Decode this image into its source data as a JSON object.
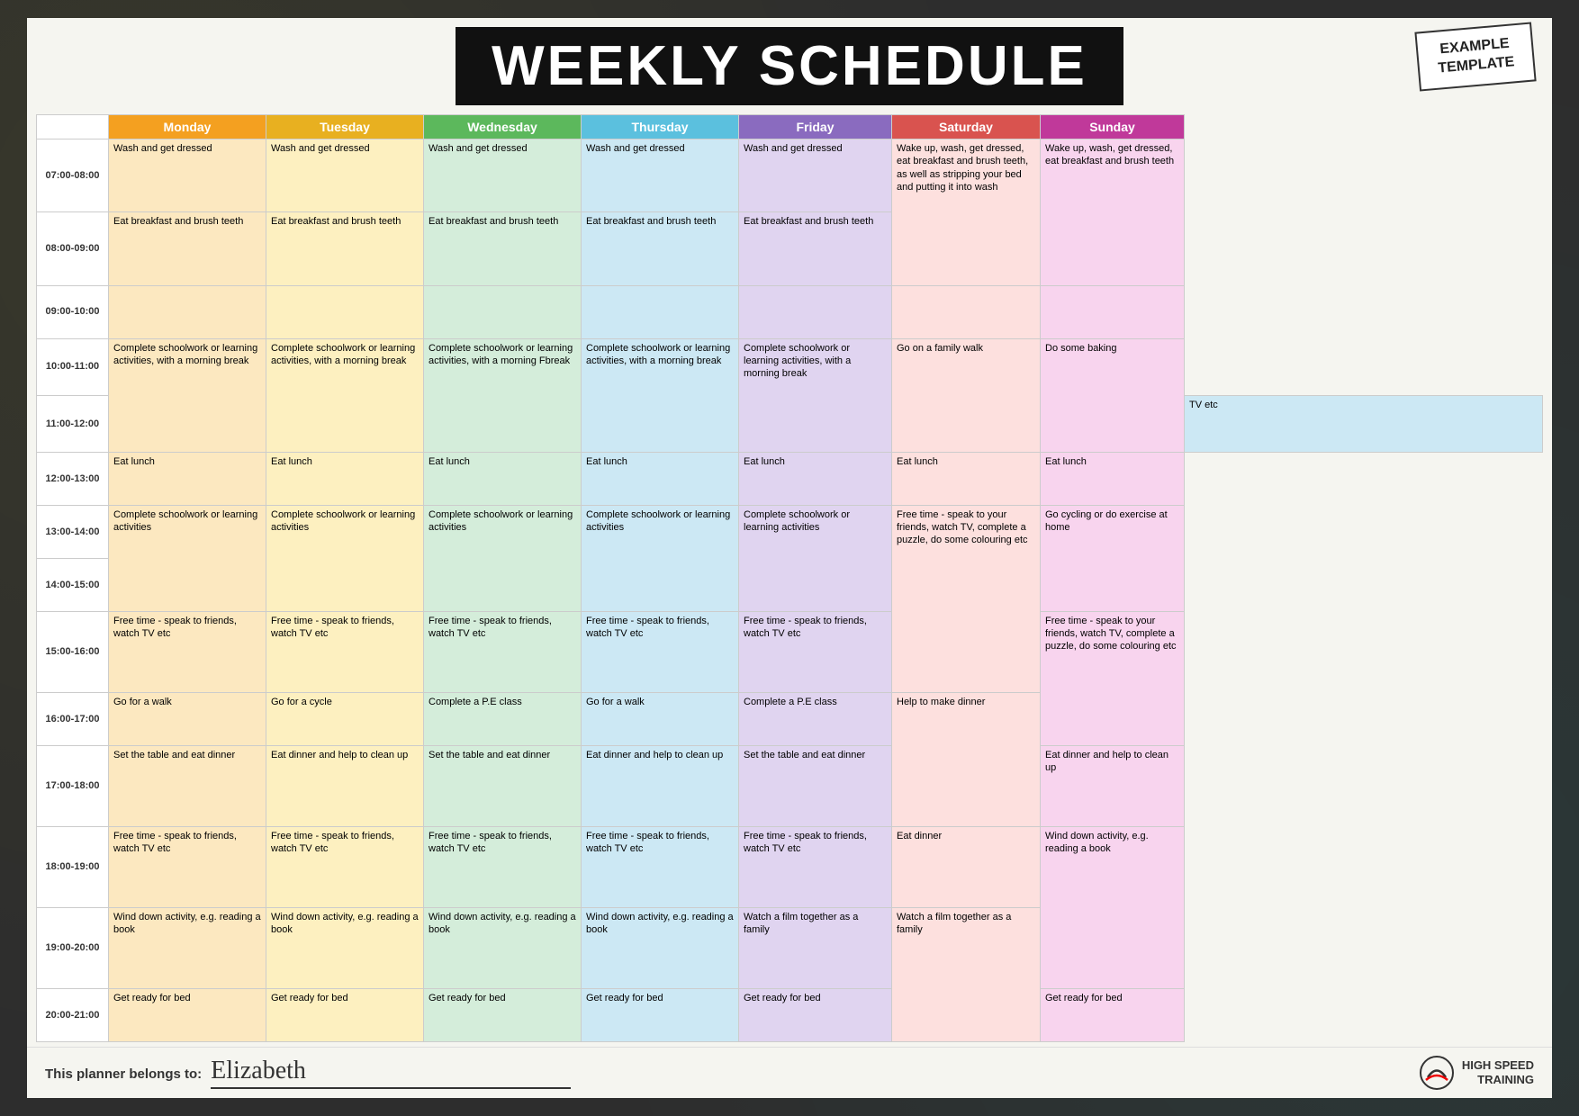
{
  "header": {
    "title": "WEEKLY SCHEDULE",
    "example_template": "EXAMPLE\nTEMPLATE"
  },
  "days": {
    "monday": "Monday",
    "tuesday": "Tuesday",
    "wednesday": "Wednesday",
    "thursday": "Thursday",
    "friday": "Friday",
    "saturday": "Saturday",
    "sunday": "Sunday"
  },
  "footer": {
    "belongs_label": "This planner belongs to:",
    "name": "Elizabeth",
    "logo_line1": "HIGH SPEED",
    "logo_line2": "TRAINING"
  },
  "schedule": [
    {
      "time": "07:00-08:00",
      "monday": "Wash and get dressed",
      "tuesday": "Wash and get dressed",
      "wednesday": "Wash and get dressed",
      "thursday": "Wash and get dressed",
      "friday": "Wash and get dressed",
      "saturday": "Wake up, wash, get dressed, eat breakfast and brush teeth, as well as stripping your bed and putting it into wash",
      "saturday_rowspan": 2,
      "sunday": "Wake up, wash, get dressed, eat breakfast and brush teeth",
      "sunday_rowspan": 2
    },
    {
      "time": "08:00-09:00",
      "monday": "Eat breakfast and brush teeth",
      "tuesday": "Eat breakfast and brush teeth",
      "wednesday": "Eat breakfast and brush teeth",
      "thursday": "Eat breakfast and brush teeth",
      "friday": "Eat breakfast and brush teeth",
      "saturday": null,
      "sunday": null
    },
    {
      "time": "09:00-10:00",
      "monday": "",
      "tuesday": "",
      "wednesday": "",
      "thursday": "",
      "friday": "",
      "saturday": "",
      "sunday": ""
    },
    {
      "time": "10:00-11:00",
      "monday": "Complete schoolwork or learning activities, with a morning break",
      "monday_rowspan": 2,
      "tuesday": "Complete schoolwork or learning activities, with a morning break",
      "tuesday_rowspan": 2,
      "wednesday": "Complete schoolwork or learning activities, with a morning Fbreak",
      "wednesday_rowspan": 2,
      "thursday": "Complete schoolwork or learning activities, with a morning break",
      "thursday_rowspan": 2,
      "friday": "Complete schoolwork or learning activities, with a morning break",
      "friday_rowspan": 2,
      "saturday": "Go on a family walk",
      "saturday_rowspan": 2,
      "sunday": "Do some baking",
      "sunday_rowspan": 2
    },
    {
      "time": "11:00-12:00",
      "monday": null,
      "tuesday": null,
      "wednesday": null,
      "thursday": "TV etc",
      "friday": null,
      "saturday": null,
      "sunday": null
    },
    {
      "time": "12:00-13:00",
      "monday": "Eat lunch",
      "tuesday": "Eat lunch",
      "wednesday": "Eat lunch",
      "thursday": "Eat lunch",
      "friday": "Eat lunch",
      "saturday": "Eat lunch",
      "sunday": "Eat lunch"
    },
    {
      "time": "13:00-14:00",
      "monday": "Complete schoolwork or learning activities",
      "monday_rowspan": 2,
      "tuesday": "Complete schoolwork or learning activities",
      "tuesday_rowspan": 2,
      "wednesday": "Complete schoolwork or learning activities",
      "wednesday_rowspan": 2,
      "thursday": "Complete schoolwork or learning activities",
      "thursday_rowspan": 2,
      "friday": "Complete schoolwork or learning activities",
      "friday_rowspan": 2,
      "saturday": "Free time - speak to your friends, watch TV, complete a puzzle, do some colouring etc",
      "saturday_rowspan": 3,
      "sunday": "Go cycling or do exercise at home",
      "sunday_rowspan": 2
    },
    {
      "time": "14:00-15:00",
      "monday": null,
      "tuesday": null,
      "wednesday": null,
      "thursday": null,
      "friday": null,
      "saturday": null,
      "sunday": null
    },
    {
      "time": "15:00-16:00",
      "monday": "Free time - speak to friends, watch TV etc",
      "tuesday": "Free time - speak to friends, watch TV etc",
      "wednesday": "Free time - speak to friends, watch TV etc",
      "thursday": "Free time - speak to friends, watch TV etc",
      "friday": "Free time - speak to friends, watch TV etc",
      "saturday": null,
      "sunday": "Free time - speak to your friends, watch TV, complete a puzzle, do some colouring etc",
      "sunday_rowspan": 2
    },
    {
      "time": "16:00-17:00",
      "monday": "Go for a walk",
      "tuesday": "Go for a cycle",
      "wednesday": "Complete a P.E class",
      "thursday": "Go for a walk",
      "friday": "Complete a P.E class",
      "saturday": "Help to make dinner",
      "saturday_rowspan": 2,
      "sunday": null
    },
    {
      "time": "17:00-18:00",
      "monday": "Set the table and eat dinner",
      "tuesday": "Eat dinner and help to clean up",
      "wednesday": "Set the table and eat dinner",
      "thursday": "Eat dinner and help to clean up",
      "friday": "Set the table and eat dinner",
      "saturday": null,
      "sunday": "Eat dinner and help to clean up"
    },
    {
      "time": "18:00-19:00",
      "monday": "Free time - speak to friends, watch TV etc",
      "tuesday": "Free time - speak to friends, watch TV etc",
      "wednesday": "Free time - speak to friends, watch TV etc",
      "thursday": "Free time - speak to friends, watch TV etc",
      "friday": "Free time - speak to friends, watch TV etc",
      "saturday": "Eat dinner",
      "sunday": "Wind down activity, e.g. reading a book",
      "sunday_rowspan": 2
    },
    {
      "time": "19:00-20:00",
      "monday": "Wind down activity, e.g. reading a book",
      "tuesday": "Wind down activity, e.g. reading a book",
      "wednesday": "Wind down activity, e.g. reading a book",
      "thursday": "Wind down activity, e.g. reading a book",
      "friday": "Watch a film together as a family",
      "saturday": "Watch a film together as a family",
      "saturday_rowspan": 2,
      "sunday": null
    },
    {
      "time": "20:00-21:00",
      "monday": "Get ready for bed",
      "tuesday": "Get ready for bed",
      "wednesday": "Get ready for bed",
      "thursday": "Get ready for bed",
      "friday": "Get ready for bed",
      "saturday": null,
      "sunday": "Get ready for bed"
    }
  ]
}
